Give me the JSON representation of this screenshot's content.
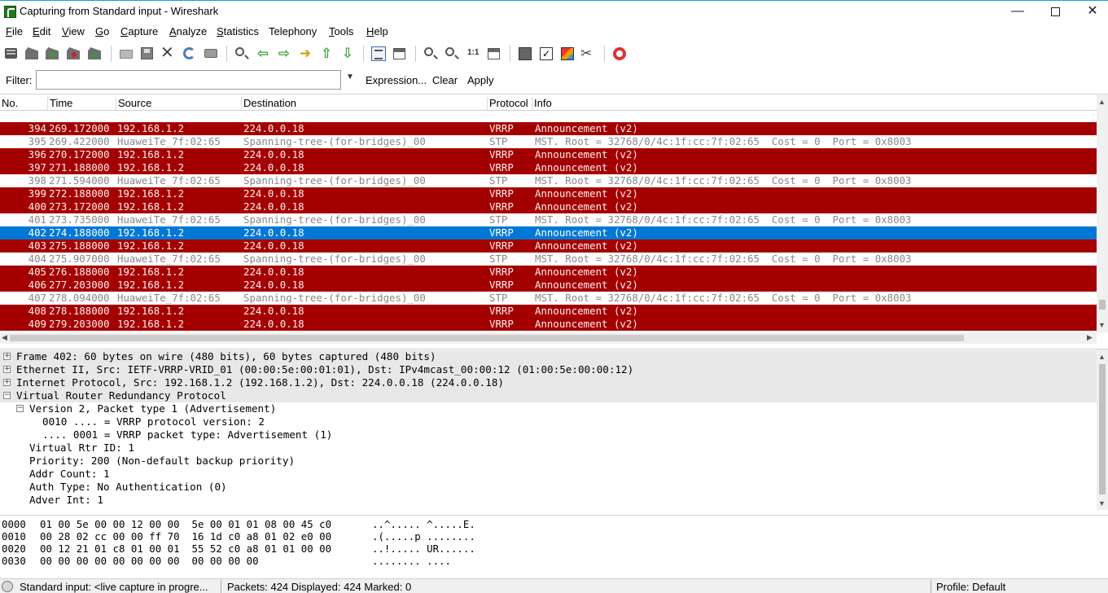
{
  "window": {
    "title": "Capturing from Standard input - Wireshark",
    "min_glyph": "—",
    "close_glyph": "✕"
  },
  "menu": [
    {
      "key": "F",
      "rest": "ile"
    },
    {
      "key": "E",
      "rest": "dit"
    },
    {
      "key": "V",
      "rest": "iew"
    },
    {
      "key": "G",
      "rest": "o"
    },
    {
      "key": "C",
      "rest": "apture"
    },
    {
      "key": "A",
      "rest": "nalyze"
    },
    {
      "key": "S",
      "rest": "tatistics"
    },
    {
      "key": "",
      "rest": "Telephony"
    },
    {
      "key": "T",
      "rest": "ools"
    },
    {
      "key": "H",
      "rest": "elp"
    }
  ],
  "toolbar_icons": {
    "close": "✕",
    "tools": "✂",
    "check": "✓",
    "left": "⇦",
    "right": "⇨",
    "goto": "➜",
    "top": "⇧",
    "bottom": "⇩",
    "zoom_reset": "1:1"
  },
  "filter": {
    "label": "Filter:",
    "value": "",
    "placeholder": "",
    "dropdown_glyph": "▼",
    "expression": "Expression...",
    "clear": "Clear",
    "apply": "Apply"
  },
  "packet_list": {
    "columns": [
      "No.",
      "Time",
      "Source",
      "Destination",
      "Protocol",
      "Info"
    ],
    "rows": [
      {
        "no": "394",
        "time": "269.172000",
        "src": "192.168.1.2",
        "dst": "224.0.0.18",
        "proto": "VRRP",
        "info": "Announcement (v2)"
      },
      {
        "no": "395",
        "time": "269.422000",
        "src": "HuaweiTe_7f:02:65",
        "dst": "Spanning-tree-(for-bridges)_00",
        "proto": "STP",
        "info": "MST. Root = 32768/0/4c:1f:cc:7f:02:65  Cost = 0  Port = 0x8003"
      },
      {
        "no": "396",
        "time": "270.172000",
        "src": "192.168.1.2",
        "dst": "224.0.0.18",
        "proto": "VRRP",
        "info": "Announcement (v2)"
      },
      {
        "no": "397",
        "time": "271.188000",
        "src": "192.168.1.2",
        "dst": "224.0.0.18",
        "proto": "VRRP",
        "info": "Announcement (v2)"
      },
      {
        "no": "398",
        "time": "271.594000",
        "src": "HuaweiTe_7f:02:65",
        "dst": "Spanning-tree-(for-bridges)_00",
        "proto": "STP",
        "info": "MST. Root = 32768/0/4c:1f:cc:7f:02:65  Cost = 0  Port = 0x8003"
      },
      {
        "no": "399",
        "time": "272.188000",
        "src": "192.168.1.2",
        "dst": "224.0.0.18",
        "proto": "VRRP",
        "info": "Announcement (v2)"
      },
      {
        "no": "400",
        "time": "273.172000",
        "src": "192.168.1.2",
        "dst": "224.0.0.18",
        "proto": "VRRP",
        "info": "Announcement (v2)"
      },
      {
        "no": "401",
        "time": "273.735000",
        "src": "HuaweiTe_7f:02:65",
        "dst": "Spanning-tree-(for-bridges)_00",
        "proto": "STP",
        "info": "MST. Root = 32768/0/4c:1f:cc:7f:02:65  Cost = 0  Port = 0x8003"
      },
      {
        "no": "402",
        "time": "274.188000",
        "src": "192.168.1.2",
        "dst": "224.0.0.18",
        "proto": "VRRP",
        "info": "Announcement (v2)"
      },
      {
        "no": "403",
        "time": "275.188000",
        "src": "192.168.1.2",
        "dst": "224.0.0.18",
        "proto": "VRRP",
        "info": "Announcement (v2)"
      },
      {
        "no": "404",
        "time": "275.907000",
        "src": "HuaweiTe_7f:02:65",
        "dst": "Spanning-tree-(for-bridges)_00",
        "proto": "STP",
        "info": "MST. Root = 32768/0/4c:1f:cc:7f:02:65  Cost = 0  Port = 0x8003"
      },
      {
        "no": "405",
        "time": "276.188000",
        "src": "192.168.1.2",
        "dst": "224.0.0.18",
        "proto": "VRRP",
        "info": "Announcement (v2)"
      },
      {
        "no": "406",
        "time": "277.203000",
        "src": "192.168.1.2",
        "dst": "224.0.0.18",
        "proto": "VRRP",
        "info": "Announcement (v2)"
      },
      {
        "no": "407",
        "time": "278.094000",
        "src": "HuaweiTe_7f:02:65",
        "dst": "Spanning-tree-(for-bridges)_00",
        "proto": "STP",
        "info": "MST. Root = 32768/0/4c:1f:cc:7f:02:65  Cost = 0  Port = 0x8003"
      },
      {
        "no": "408",
        "time": "278.188000",
        "src": "192.168.1.2",
        "dst": "224.0.0.18",
        "proto": "VRRP",
        "info": "Announcement (v2)"
      },
      {
        "no": "409",
        "time": "279.203000",
        "src": "192.168.1.2",
        "dst": "224.0.0.18",
        "proto": "VRRP",
        "info": "Announcement (v2)"
      }
    ],
    "selected_no": "402",
    "colors": {
      "vrrp_bg": "#a40000",
      "stp_bg": "#ffffff",
      "selected_bg": "#0078d7"
    }
  },
  "details": {
    "lines": [
      {
        "text": "Frame 402: 60 bytes on wire (480 bits), 60 bytes captured (480 bits)",
        "expander": "+"
      },
      {
        "text": "Ethernet II, Src: IETF-VRRP-VRID_01 (00:00:5e:00:01:01), Dst: IPv4mcast_00:00:12 (01:00:5e:00:00:12)",
        "expander": "+"
      },
      {
        "text": "Internet Protocol, Src: 192.168.1.2 (192.168.1.2), Dst: 224.0.0.18 (224.0.0.18)",
        "expander": "+"
      },
      {
        "text": "Virtual Router Redundancy Protocol",
        "expander": "−"
      },
      {
        "text": "Version 2, Packet type 1 (Advertisement)",
        "expander": "−"
      },
      {
        "text": "0010 .... = VRRP protocol version: 2",
        "expander": ""
      },
      {
        "text": ".... 0001 = VRRP packet type: Advertisement (1)",
        "expander": ""
      },
      {
        "text": "Virtual Rtr ID: 1",
        "expander": ""
      },
      {
        "text": "Priority: 200 (Non-default backup priority)",
        "expander": ""
      },
      {
        "text": "Addr Count: 1",
        "expander": ""
      },
      {
        "text": "Auth Type: No Authentication (0)",
        "expander": ""
      },
      {
        "text": "Adver Int: 1",
        "expander": ""
      }
    ]
  },
  "bytes": {
    "rows": [
      {
        "offset": "0000",
        "hex": "01 00 5e 00 00 12 00 00  5e 00 01 01 08 00 45 c0",
        "ascii": "..^..... ^.....E."
      },
      {
        "offset": "0010",
        "hex": "00 28 02 cc 00 00 ff 70  16 1d c0 a8 01 02 e0 00",
        "ascii": ".(.....p ........"
      },
      {
        "offset": "0020",
        "hex": "00 12 21 01 c8 01 00 01  55 52 c0 a8 01 01 00 00",
        "ascii": "..!..... UR......"
      },
      {
        "offset": "0030",
        "hex": "00 00 00 00 00 00 00 00  00 00 00 00",
        "ascii": "........ ...."
      }
    ]
  },
  "status": {
    "input": "Standard input: <live capture in progre...",
    "packets": "Packets: 424 Displayed: 424 Marked: 0",
    "profile": "Profile: Default"
  }
}
